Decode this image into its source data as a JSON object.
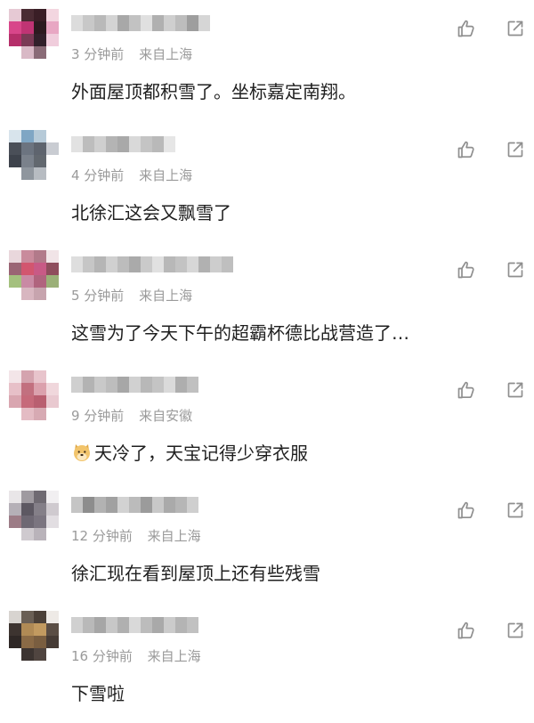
{
  "comments": [
    {
      "time": "3 分钟前",
      "location": "来自上海",
      "text": "外面屋顶都积雪了。坐标嘉定南翔。",
      "avatar_pixels": [
        "#e6c9d4",
        "#4a2b33",
        "#3a1e26",
        "#f3d6e0",
        "#d8468a",
        "#c03474",
        "#2c1a1f",
        "#e8a7c3",
        "#b52f6a",
        "#7a3a55",
        "#31202a",
        "#f0cddc",
        "#ffffff",
        "#d9b9c6",
        "#8a6b77",
        "#ffffff"
      ],
      "username_pixels": [
        "#dcdcdc",
        "#c8c8c8",
        "#b9b9b9",
        "#d4d4d4",
        "#a8a8a8",
        "#c2c2c2",
        "#e0e0e0",
        "#b0b0b0",
        "#cfcfcf",
        "#bdbdbd",
        "#9e9e9e",
        "#d6d6d6"
      ]
    },
    {
      "time": "4 分钟前",
      "location": "来自上海",
      "text": "北徐汇这会又飘雪了",
      "avatar_pixels": [
        "#d8e4ec",
        "#7fa6c4",
        "#b6cad8",
        "#ffffff",
        "#4a4f58",
        "#6c7480",
        "#5e646e",
        "#c9ccd2",
        "#3e434c",
        "#7a818b",
        "#62686f",
        "#ffffff",
        "#ffffff",
        "#8f969e",
        "#b7bcc2",
        "#ffffff"
      ],
      "username_pixels": [
        "#e2e2e2",
        "#bdbdbd",
        "#cfcfcf",
        "#b4b4b4",
        "#a9a9a9",
        "#d9d9d9",
        "#c4c4c4",
        "#b9b9b9",
        "#e6e6e6"
      ]
    },
    {
      "time": "5 分钟前",
      "location": "来自上海",
      "text": "这雪为了今天下午的超霸杯德比战营造了…",
      "avatar_pixels": [
        "#e9d7dc",
        "#c98b9c",
        "#b27a8a",
        "#f1e4e7",
        "#9a6474",
        "#d2566f",
        "#c85a86",
        "#8f4d5d",
        "#a4c07e",
        "#c98aa4",
        "#b0647e",
        "#9bb078",
        "#ffffff",
        "#d8b6c0",
        "#c7a4ae",
        "#ffffff"
      ],
      "username_pixels": [
        "#dedede",
        "#c6c6c6",
        "#b5b5b5",
        "#d0d0d0",
        "#bcbcbc",
        "#aaaaaa",
        "#cacaca",
        "#e1e1e1",
        "#b8b8b8",
        "#c3c3c3",
        "#d7d7d7",
        "#b1b1b1",
        "#cdcdcd",
        "#bfbfbf"
      ]
    },
    {
      "time": "9 分钟前",
      "location": "来自安徽",
      "text": "天冷了，天宝记得少穿衣服",
      "avatar_pixels": [
        "#f3e5e8",
        "#d4a3ae",
        "#e8c4cc",
        "#ffffff",
        "#e7c0c8",
        "#c2707f",
        "#dba1ad",
        "#f0d7dc",
        "#d9a6b0",
        "#c66a7a",
        "#b95f70",
        "#e9c9d0",
        "#ffffff",
        "#e4bcc4",
        "#d7aab3",
        "#ffffff"
      ],
      "username_pixels": [
        "#cfcfcf",
        "#b3b3b3",
        "#c9c9c9",
        "#bdbdbd",
        "#a7a7a7",
        "#d1d1d1",
        "#b8b8b8",
        "#c4c4c4",
        "#dadada",
        "#aeaeae",
        "#c0c0c0"
      ]
    },
    {
      "time": "12 分钟前",
      "location": "来自上海",
      "text": "徐汇现在看到屋顶上还有些残雪",
      "avatar_pixels": [
        "#e9e6e8",
        "#9f9aa0",
        "#6f6a72",
        "#f1eff1",
        "#b5b0b7",
        "#5d5862",
        "#847f88",
        "#cfcacf",
        "#9c7c86",
        "#6e6873",
        "#7b7580",
        "#e2dee2",
        "#ffffff",
        "#cfcacf",
        "#b9b3ba",
        "#ffffff"
      ],
      "username_pixels": [
        "#c5c5c5",
        "#8d8d8d",
        "#b2b2b2",
        "#a1a1a1",
        "#d2d2d2",
        "#bbbbbb",
        "#9b9b9b",
        "#c8c8c8",
        "#aaaaaa",
        "#b6b6b6",
        "#cfcfcf"
      ]
    },
    {
      "time": "16 分钟前",
      "location": "来自上海",
      "text": "下雪啦",
      "avatar_pixels": [
        "#d8d4d0",
        "#6a5f55",
        "#4b4038",
        "#eeeae6",
        "#3d3430",
        "#b08a55",
        "#c29a60",
        "#5a4d44",
        "#2f2826",
        "#8a6a46",
        "#7a5e40",
        "#463b35",
        "#ffffff",
        "#3c3431",
        "#504540",
        "#ffffff"
      ],
      "username_pixels": [
        "#d0d0d0",
        "#b9b9b9",
        "#a6a6a6",
        "#c7c7c7",
        "#b0b0b0",
        "#d9d9d9",
        "#bcbcbc",
        "#a9a9a9",
        "#cbcbcb",
        "#b4b4b4",
        "#c1c1c1"
      ]
    }
  ],
  "icons": {
    "like": "thumbs-up-outline-icon",
    "share": "share-box-arrow-icon",
    "emoji": "doge-emoji-icon"
  },
  "colors": {
    "text": "#1f1f1f",
    "meta": "#9a9a9a",
    "icon": "#8f8f8f",
    "background": "#ffffff"
  }
}
